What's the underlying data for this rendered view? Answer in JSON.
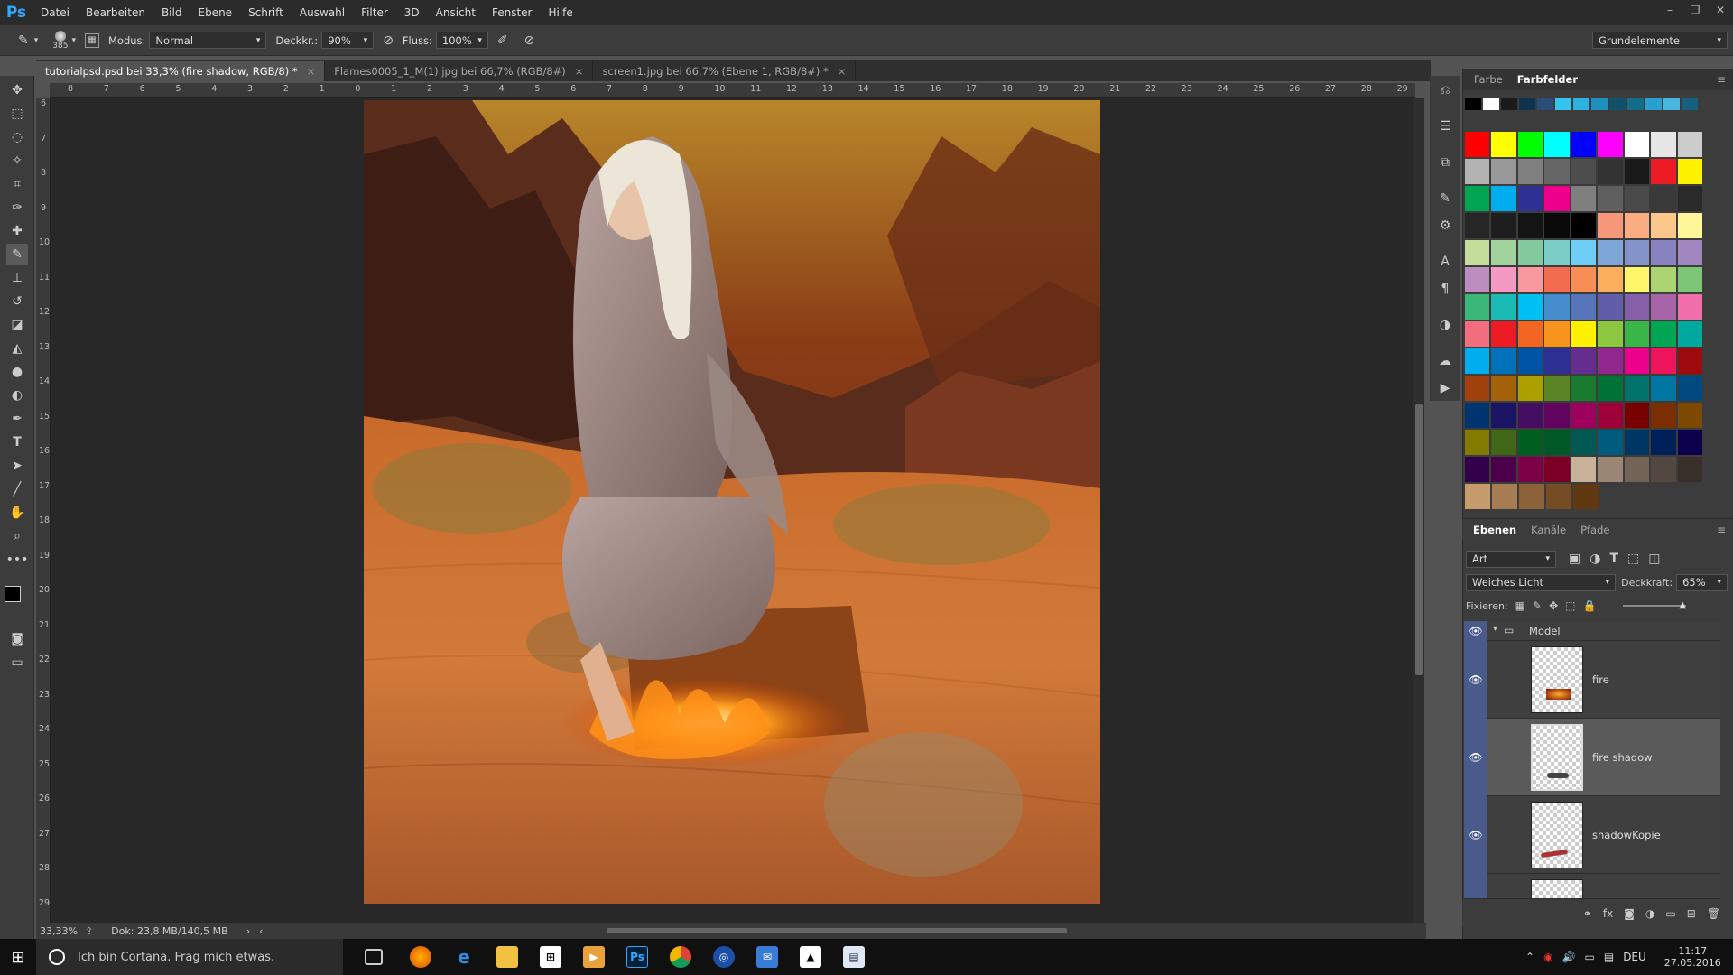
{
  "app": {
    "logo": "Ps"
  },
  "menu": [
    "Datei",
    "Bearbeiten",
    "Bild",
    "Ebene",
    "Schrift",
    "Auswahl",
    "Filter",
    "3D",
    "Ansicht",
    "Fenster",
    "Hilfe"
  ],
  "options": {
    "brush_size": "385",
    "mode_label": "Modus:",
    "mode_value": "Normal",
    "opacity_label": "Deckkr.:",
    "opacity_value": "90%",
    "flow_label": "Fluss:",
    "flow_value": "100%",
    "workspace": "Grundelemente"
  },
  "tabs": [
    {
      "label": "tutorialpsd.psd bei 33,3% (fire shadow, RGB/8) *",
      "active": true
    },
    {
      "label": "Flames0005_1_M(1).jpg bei 66,7% (RGB/8#)",
      "active": false
    },
    {
      "label": "screen1.jpg bei 66,7% (Ebene 1, RGB/8#) *",
      "active": false
    }
  ],
  "ruler_top": [
    "8",
    "7",
    "6",
    "5",
    "4",
    "3",
    "2",
    "1",
    "0",
    "1",
    "2",
    "3",
    "4",
    "5",
    "6",
    "7",
    "8",
    "9",
    "10",
    "11",
    "12",
    "13",
    "14",
    "15",
    "16",
    "17",
    "18",
    "19",
    "20",
    "21",
    "22",
    "23",
    "24",
    "25",
    "26",
    "27",
    "28",
    "29"
  ],
  "ruler_left": [
    "6",
    "7",
    "8",
    "9",
    "10",
    "11",
    "12",
    "13",
    "14",
    "15",
    "16",
    "17",
    "18",
    "19",
    "20",
    "21",
    "22",
    "23",
    "24",
    "25",
    "26",
    "27",
    "28",
    "29"
  ],
  "status": {
    "zoom": "33,33%",
    "doc": "Dok: 23,8 MB/140,5 MB"
  },
  "color_panel": {
    "tabs": [
      "Farbe",
      "Farbfelder"
    ],
    "active": "Farbfelder"
  },
  "swatch_rows": [
    [
      "#000000",
      "#ffffff",
      "#1a1a1a",
      "#0e3350",
      "#2a4e78",
      "#35c4f0",
      "#2db3e0",
      "#1f8fc0",
      "#13506b",
      "#146e8a",
      "#2b9fd0",
      "#49b8e0",
      "#165f80"
    ],
    [
      "#ff0000",
      "#ffff00",
      "#00ff00",
      "#00ffff",
      "#0000ff",
      "#ff00ff",
      "#ffffff",
      "#e6e6e6",
      "#cccccc"
    ],
    [
      "#b3b3b3",
      "#999999",
      "#808080",
      "#666666",
      "#4d4d4d",
      "#333333",
      "#1a1a1a",
      "#ed1c24",
      "#fff200"
    ],
    [
      "#00a651",
      "#00aeef",
      "#2e3192",
      "#ec008c",
      "#7f7f7f",
      "#5f5f5f",
      "#4a4a4a",
      "#3a3a3a",
      "#2a2a2a"
    ],
    [
      "#262626",
      "#1e1e1e",
      "#141414",
      "#0a0a0a",
      "#000000",
      "#f7977a",
      "#f9ad81",
      "#fdc68a",
      "#fff79a"
    ],
    [
      "#c4df9b",
      "#a3d39c",
      "#82ca9d",
      "#7bcdc8",
      "#6ecff6",
      "#7ea7d8",
      "#8493ca",
      "#8882be",
      "#a187be"
    ],
    [
      "#bc8dbf",
      "#f49ac2",
      "#f6989d",
      "#f26c4f",
      "#f68e56",
      "#fbaf5d",
      "#fff568",
      "#acd372",
      "#7cc576"
    ],
    [
      "#3bb878",
      "#1abbb4",
      "#00bff3",
      "#448ccb",
      "#5674b9",
      "#605ca8",
      "#855fa8",
      "#a864a8",
      "#f06eaa"
    ],
    [
      "#f26d7d",
      "#ed1c24",
      "#f26522",
      "#f7941d",
      "#fff200",
      "#8dc63f",
      "#39b54a",
      "#00a651",
      "#00a99d"
    ],
    [
      "#00aeef",
      "#0072bc",
      "#0054a6",
      "#2e3192",
      "#662d91",
      "#92278f",
      "#ec008c",
      "#ed145b",
      "#9e0b0f"
    ],
    [
      "#a0410d",
      "#a3620a",
      "#aba000",
      "#598527",
      "#197b30",
      "#007236",
      "#00746b",
      "#0076a3",
      "#004a80"
    ],
    [
      "#003471",
      "#1b1464",
      "#440e62",
      "#630460",
      "#9e005d",
      "#9e0039",
      "#790000",
      "#7b2e00",
      "#7d4900"
    ],
    [
      "#827b00",
      "#406618",
      "#005e20",
      "#005826",
      "#005952",
      "#005b7f",
      "#003663",
      "#002157",
      "#0d004c"
    ],
    [
      "#32004b",
      "#4b0049",
      "#7b0046",
      "#7a0026",
      "#c7b299",
      "#998675",
      "#736357",
      "#534741",
      "#37302a"
    ],
    [
      "#c69c6d",
      "#a67c52",
      "#8c6239",
      "#754c24",
      "#603913"
    ]
  ],
  "layers_panel": {
    "tabs": [
      "Ebenen",
      "Kanäle",
      "Pfade"
    ],
    "active": "Ebenen",
    "filter": "Art",
    "blend": "Weiches Licht",
    "opacity_label": "Deckkraft:",
    "opacity": "65%",
    "lock_label": "Fixieren:",
    "group": "Model",
    "layers": [
      {
        "name": "fire",
        "selected": false
      },
      {
        "name": "fire shadow",
        "selected": true
      },
      {
        "name": "shadowKopie",
        "selected": false
      }
    ]
  },
  "taskbar": {
    "search": "Ich bin Cortana. Frag mich etwas.",
    "lang": "DEU",
    "time": "11:17",
    "date": "27.05.2016"
  }
}
